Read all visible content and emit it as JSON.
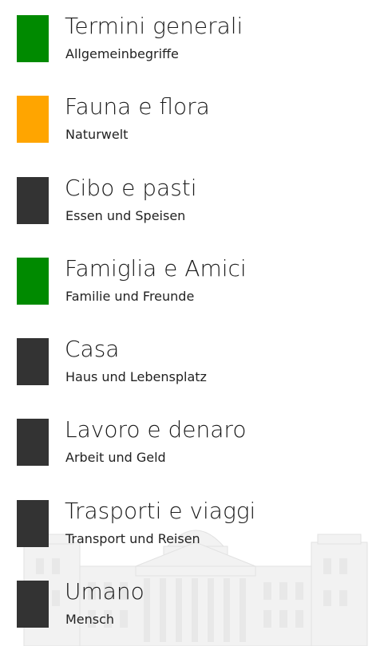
{
  "categories": [
    {
      "title": "Termini generali",
      "subtitle": "Allgemeinbegriffe",
      "color": "#008a00"
    },
    {
      "title": "Fauna e flora",
      "subtitle": "Naturwelt",
      "color": "#ffa500"
    },
    {
      "title": "Cibo e pasti",
      "subtitle": "Essen und Speisen",
      "color": "#333333"
    },
    {
      "title": "Famiglia e Amici",
      "subtitle": "Familie und Freunde",
      "color": "#008a00"
    },
    {
      "title": "Casa",
      "subtitle": "Haus und Lebensplatz",
      "color": "#333333"
    },
    {
      "title": "Lavoro e denaro",
      "subtitle": "Arbeit und Geld",
      "color": "#333333"
    },
    {
      "title": "Trasporti e viaggi",
      "subtitle": "Transport und Reisen",
      "color": "#333333"
    },
    {
      "title": "Umano",
      "subtitle": "Mensch",
      "color": "#333333"
    }
  ],
  "background_image": "reichstag-building-watermark"
}
